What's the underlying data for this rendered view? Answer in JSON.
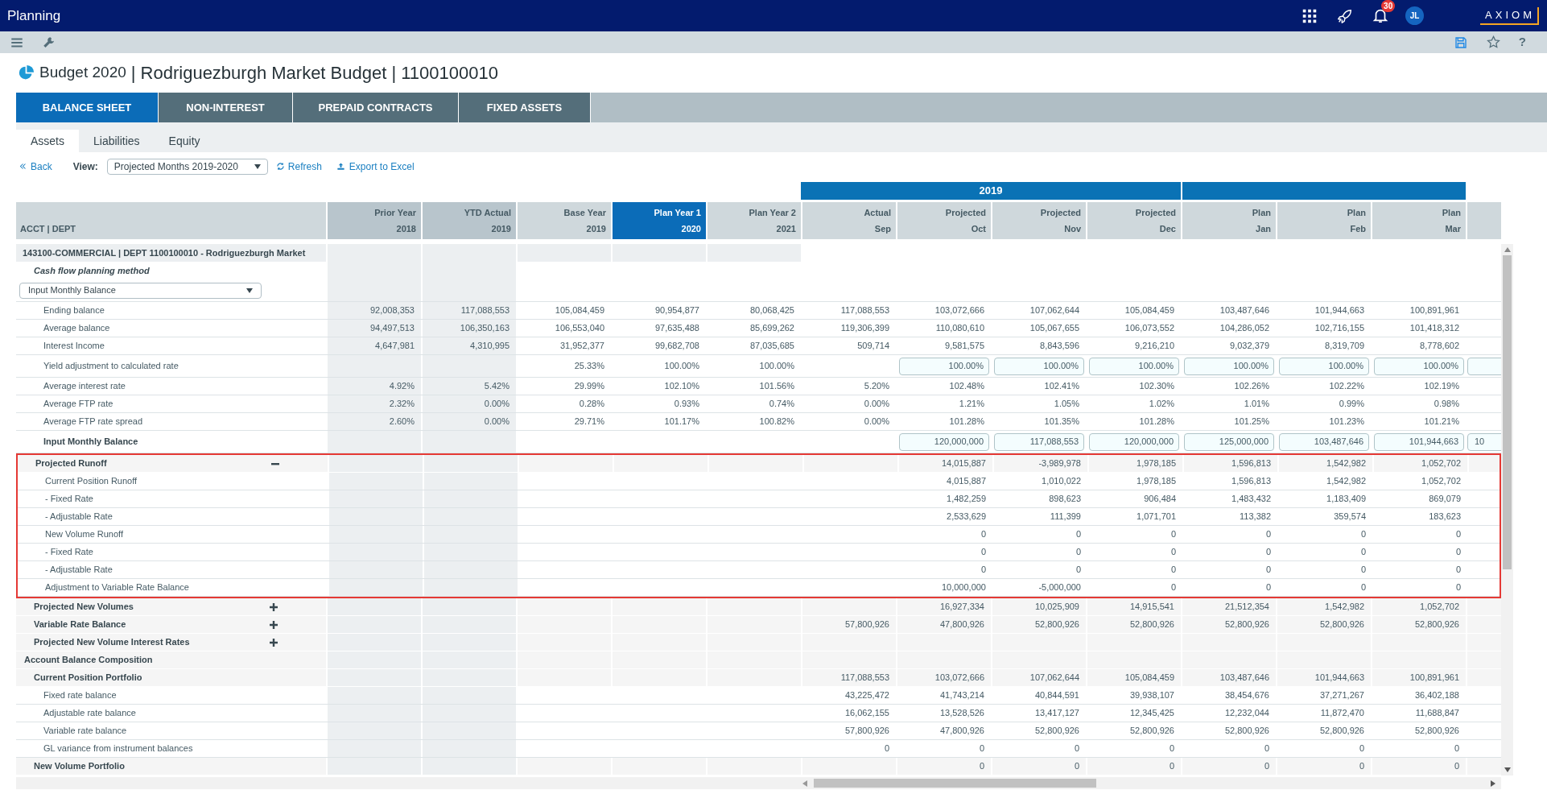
{
  "app": {
    "title": "Planning",
    "notification_count": "30",
    "avatar": "JL",
    "logo": "AXIOM"
  },
  "toolbar": {
    "help": "?"
  },
  "page": {
    "title_prefix": "Budget 2020",
    "title": "| Rodriguezburgh Market Budget | 1100100010"
  },
  "main_tabs": [
    {
      "label": "BALANCE SHEET",
      "selected": true
    },
    {
      "label": "NON-INTEREST",
      "selected": false
    },
    {
      "label": "PREPAID CONTRACTS",
      "selected": false
    },
    {
      "label": "FIXED ASSETS",
      "selected": false
    }
  ],
  "sub_tabs": [
    {
      "label": "Assets",
      "selected": true
    },
    {
      "label": "Liabilities",
      "selected": false
    },
    {
      "label": "Equity",
      "selected": false
    }
  ],
  "actions": {
    "back": "Back",
    "view_label": "View:",
    "view_value": "Projected Months 2019-2020",
    "refresh": "Refresh",
    "export": "Export to Excel"
  },
  "grid": {
    "year_band": "2019",
    "label_header": "ACCT | DEPT",
    "columns": [
      {
        "title": "Prior Year",
        "sub": "2018",
        "shaded": true,
        "selected": false
      },
      {
        "title": "YTD Actual",
        "sub": "2019",
        "shaded": true,
        "selected": false
      },
      {
        "title": "Base Year",
        "sub": "2019",
        "shaded": false,
        "selected": false
      },
      {
        "title": "Plan Year 1",
        "sub": "2020",
        "shaded": false,
        "selected": true
      },
      {
        "title": "Plan Year 2",
        "sub": "2021",
        "shaded": false,
        "selected": false
      },
      {
        "title": "Actual",
        "sub": "Sep",
        "shaded": false,
        "selected": false
      },
      {
        "title": "Projected",
        "sub": "Oct",
        "shaded": false,
        "selected": false
      },
      {
        "title": "Projected",
        "sub": "Nov",
        "shaded": false,
        "selected": false
      },
      {
        "title": "Projected",
        "sub": "Dec",
        "shaded": false,
        "selected": false
      },
      {
        "title": "Plan",
        "sub": "Jan",
        "shaded": false,
        "selected": false
      },
      {
        "title": "Plan",
        "sub": "Feb",
        "shaded": false,
        "selected": false
      },
      {
        "title": "Plan",
        "sub": "Mar",
        "shaded": false,
        "selected": false
      }
    ],
    "rows": [
      {
        "label": "143100-COMMERCIAL | DEPT 1100100010 - Rodriguezburgh Market",
        "kind": "account",
        "highlighted": false
      },
      {
        "label": "Cash flow planning method",
        "kind": "subhead",
        "highlighted": false
      },
      {
        "label": "Input Monthly Balance",
        "kind": "select",
        "highlighted": false
      },
      {
        "label": "Ending balance",
        "kind": "data",
        "highlighted": false,
        "values": {
          "prior_year": "92,008,353",
          "ytd_actual": "117,088,553",
          "base_year": "105,084,459",
          "plan_year_1": "90,954,877",
          "plan_year_2": "80,068,425",
          "sep": "117,088,553",
          "oct": "103,072,666",
          "nov": "107,062,644",
          "dec": "105,084,459",
          "jan": "103,487,646",
          "feb": "101,944,663",
          "mar": "100,891,961"
        }
      },
      {
        "label": "Average balance",
        "kind": "data",
        "highlighted": false,
        "values": {
          "prior_year": "94,497,513",
          "ytd_actual": "106,350,163",
          "base_year": "106,553,040",
          "plan_year_1": "97,635,488",
          "plan_year_2": "85,699,262",
          "sep": "119,306,399",
          "oct": "110,080,610",
          "nov": "105,067,655",
          "dec": "106,073,552",
          "jan": "104,286,052",
          "feb": "102,716,155",
          "mar": "101,418,312"
        }
      },
      {
        "label": "Interest Income",
        "kind": "data",
        "highlighted": false,
        "values": {
          "prior_year": "4,647,981",
          "ytd_actual": "4,310,995",
          "base_year": "31,952,377",
          "plan_year_1": "99,682,708",
          "plan_year_2": "87,035,685",
          "sep": "509,714",
          "oct": "9,581,575",
          "nov": "8,843,596",
          "dec": "9,216,210",
          "jan": "9,032,379",
          "feb": "8,319,709",
          "mar": "8,778,602"
        }
      },
      {
        "label": "Yield adjustment to calculated rate",
        "kind": "input",
        "highlighted": false,
        "values": {
          "base_year": "25.33%",
          "plan_year_1": "100.00%",
          "plan_year_2": "100.00%",
          "oct": "100.00%",
          "nov": "100.00%",
          "dec": "100.00%",
          "jan": "100.00%",
          "feb": "100.00%",
          "mar": "100.00%"
        }
      },
      {
        "label": "Average interest rate",
        "kind": "data",
        "highlighted": false,
        "values": {
          "prior_year": "4.92%",
          "ytd_actual": "5.42%",
          "base_year": "29.99%",
          "plan_year_1": "102.10%",
          "plan_year_2": "101.56%",
          "sep": "5.20%",
          "oct": "102.48%",
          "nov": "102.41%",
          "dec": "102.30%",
          "jan": "102.26%",
          "feb": "102.22%",
          "mar": "102.19%"
        }
      },
      {
        "label": "Average FTP rate",
        "kind": "data",
        "highlighted": false,
        "values": {
          "prior_year": "2.32%",
          "ytd_actual": "0.00%",
          "base_year": "0.28%",
          "plan_year_1": "0.93%",
          "plan_year_2": "0.74%",
          "sep": "0.00%",
          "oct": "1.21%",
          "nov": "1.05%",
          "dec": "1.02%",
          "jan": "1.01%",
          "feb": "0.99%",
          "mar": "0.98%"
        }
      },
      {
        "label": "Average FTP rate spread",
        "kind": "data",
        "highlighted": false,
        "values": {
          "prior_year": "2.60%",
          "ytd_actual": "0.00%",
          "base_year": "29.71%",
          "plan_year_1": "101.17%",
          "plan_year_2": "100.82%",
          "sep": "0.00%",
          "oct": "101.28%",
          "nov": "101.35%",
          "dec": "101.28%",
          "jan": "101.25%",
          "feb": "101.23%",
          "mar": "101.21%"
        }
      },
      {
        "label": "Input Monthly Balance",
        "kind": "input_total",
        "highlighted": false,
        "values": {
          "oct": "120,000,000",
          "nov": "117,088,553",
          "dec": "120,000,000",
          "jan": "125,000,000",
          "feb": "103,487,646",
          "mar": "101,944,663",
          "column_14": "10"
        }
      },
      {
        "label": "Projected Runoff",
        "kind": "section",
        "expanded": true,
        "highlighted": true,
        "values": {
          "oct": "14,015,887",
          "nov": "-3,989,978",
          "dec": "1,978,185",
          "jan": "1,596,813",
          "feb": "1,542,982",
          "mar": "1,052,702"
        }
      },
      {
        "label": "Current Position Runoff",
        "kind": "data",
        "highlighted": true,
        "values": {
          "oct": "4,015,887",
          "nov": "1,010,022",
          "dec": "1,978,185",
          "jan": "1,596,813",
          "feb": "1,542,982",
          "mar": "1,052,702"
        }
      },
      {
        "label": "- Fixed Rate",
        "kind": "data",
        "highlighted": true,
        "values": {
          "oct": "1,482,259",
          "nov": "898,623",
          "dec": "906,484",
          "jan": "1,483,432",
          "feb": "1,183,409",
          "mar": "869,079"
        }
      },
      {
        "label": "- Adjustable Rate",
        "kind": "data",
        "highlighted": true,
        "values": {
          "oct": "2,533,629",
          "nov": "111,399",
          "dec": "1,071,701",
          "jan": "113,382",
          "feb": "359,574",
          "mar": "183,623"
        }
      },
      {
        "label": "New Volume Runoff",
        "kind": "data",
        "highlighted": true,
        "values": {
          "oct": "0",
          "nov": "0",
          "dec": "0",
          "jan": "0",
          "feb": "0",
          "mar": "0"
        }
      },
      {
        "label": "- Fixed Rate",
        "kind": "data",
        "highlighted": true,
        "values": {
          "oct": "0",
          "nov": "0",
          "dec": "0",
          "jan": "0",
          "feb": "0",
          "mar": "0"
        }
      },
      {
        "label": "- Adjustable Rate",
        "kind": "data",
        "highlighted": true,
        "values": {
          "oct": "0",
          "nov": "0",
          "dec": "0",
          "jan": "0",
          "feb": "0",
          "mar": "0"
        }
      },
      {
        "label": "Adjustment to Variable Rate Balance",
        "kind": "data",
        "highlighted": true,
        "values": {
          "oct": "10,000,000",
          "nov": "-5,000,000",
          "dec": "0",
          "jan": "0",
          "feb": "0",
          "mar": "0"
        }
      },
      {
        "label": "Projected New Volumes",
        "kind": "section",
        "expanded": false,
        "highlighted": false,
        "values": {
          "oct": "16,927,334",
          "nov": "10,025,909",
          "dec": "14,915,541",
          "jan": "21,512,354",
          "feb": "1,542,982",
          "mar": "1,052,702"
        }
      },
      {
        "label": "Variable Rate Balance",
        "kind": "section",
        "expanded": false,
        "highlighted": false,
        "values": {
          "sep": "57,800,926",
          "oct": "47,800,926",
          "nov": "52,800,926",
          "dec": "52,800,926",
          "jan": "52,800,926",
          "feb": "52,800,926",
          "mar": "52,800,926"
        }
      },
      {
        "label": "Projected New Volume Interest Rates",
        "kind": "section",
        "expanded": false,
        "highlighted": false
      },
      {
        "label": "Account Balance Composition",
        "kind": "heading",
        "highlighted": false
      },
      {
        "label": "Current Position Portfolio",
        "kind": "section",
        "highlighted": false,
        "values": {
          "sep": "117,088,553",
          "oct": "103,072,666",
          "nov": "107,062,644",
          "dec": "105,084,459",
          "jan": "103,487,646",
          "feb": "101,944,663",
          "mar": "100,891,961"
        }
      },
      {
        "label": "Fixed rate balance",
        "kind": "data",
        "highlighted": false,
        "values": {
          "sep": "43,225,472",
          "oct": "41,743,214",
          "nov": "40,844,591",
          "dec": "39,938,107",
          "jan": "38,454,676",
          "feb": "37,271,267",
          "mar": "36,402,188"
        }
      },
      {
        "label": "Adjustable rate balance",
        "kind": "data",
        "highlighted": false,
        "values": {
          "sep": "16,062,155",
          "oct": "13,528,526",
          "nov": "13,417,127",
          "dec": "12,345,425",
          "jan": "12,232,044",
          "feb": "11,872,470",
          "mar": "11,688,847"
        }
      },
      {
        "label": "Variable rate balance",
        "kind": "data",
        "highlighted": false,
        "values": {
          "sep": "57,800,926",
          "oct": "47,800,926",
          "nov": "52,800,926",
          "dec": "52,800,926",
          "jan": "52,800,926",
          "feb": "52,800,926",
          "mar": "52,800,926"
        }
      },
      {
        "label": "GL variance from instrument balances",
        "kind": "data",
        "highlighted": false,
        "values": {
          "sep": "0",
          "oct": "0",
          "nov": "0",
          "dec": "0",
          "jan": "0",
          "feb": "0",
          "mar": "0"
        }
      },
      {
        "label": "New Volume Portfolio",
        "kind": "section",
        "highlighted": false,
        "values": {
          "oct": "0",
          "nov": "0",
          "dec": "0",
          "jan": "0",
          "feb": "0",
          "mar": "0"
        }
      }
    ]
  }
}
